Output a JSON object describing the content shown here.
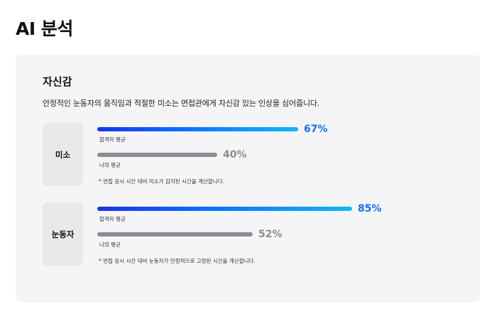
{
  "page": {
    "title": "AI 분석"
  },
  "section": {
    "title": "자신감",
    "description": "안정적인 눈동자의 움직임과 적절한 미소는 면접관에게 자신감 있는 인상을 심어줍니다."
  },
  "metrics": [
    {
      "label": "미소",
      "pass_caption": "합격자 평균",
      "pass_value": 67,
      "pass_value_text": "67%",
      "my_caption": "나의 평균",
      "my_value": 40,
      "my_value_text": "40%",
      "footnote": "* 면접 응시 시간 대비 미소가 감지된 시간을 계산합니다."
    },
    {
      "label": "눈동자",
      "pass_caption": "합격자 평균",
      "pass_value": 85,
      "pass_value_text": "85%",
      "my_caption": "나의 평균",
      "my_value": 52,
      "my_value_text": "52%",
      "footnote": "* 면접 응시 시간 대비 눈동자가 안정적으로 고정된 시간을 계산합니다."
    }
  ],
  "colors": {
    "pass_gradient_start": "#1a33ea",
    "pass_gradient_end": "#12b8f4",
    "pass_text": "#1670f5",
    "mine": "#8c8c91",
    "card_background": "#f5f5f7"
  }
}
